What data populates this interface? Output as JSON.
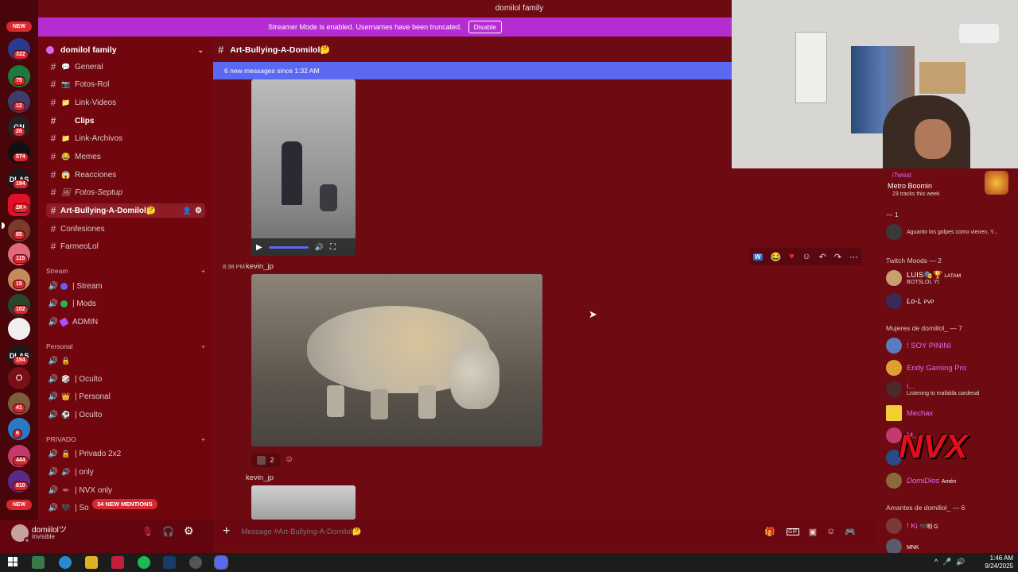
{
  "window": {
    "title": "domilol family"
  },
  "streamer_banner": {
    "message": "Streamer Mode is enabled. Usernames have been truncated.",
    "disable_label": "Disable"
  },
  "servers": {
    "new_top": "NEW",
    "new_bottom": "NEW",
    "badges": [
      "322",
      "75",
      "12",
      "26",
      "574",
      "194",
      "2K+",
      "85",
      "115",
      "15",
      "102",
      "154",
      "41",
      "6",
      "444",
      "810"
    ],
    "letter_o": "O"
  },
  "sidebar": {
    "guild_name": "domilol family",
    "channels": [
      {
        "emoji": "💬",
        "label": "General"
      },
      {
        "emoji": "📷",
        "label": "Fotos-Rol"
      },
      {
        "emoji": "📁",
        "label": "Link-Videos"
      },
      {
        "emoji": "",
        "label": "Clips"
      },
      {
        "emoji": "📁",
        "label": "Link-Archivos"
      },
      {
        "emoji": "😂",
        "label": "Memes"
      },
      {
        "emoji": "😱",
        "label": "Reacciones"
      },
      {
        "emoji": "🖼",
        "label": "Fotos-Septup"
      },
      {
        "emoji": "",
        "label": "Art-Bullying-A-Domilol🤔"
      },
      {
        "emoji": "",
        "label": "Confesiones"
      },
      {
        "emoji": "",
        "label": "FarmeoLol"
      }
    ],
    "cat_stream": "Stream",
    "voice_stream": [
      {
        "label": "| Stream",
        "dot": "#6a5cff"
      },
      {
        "label": "| Mods",
        "dot": "#1db954"
      },
      {
        "label": "ADMIN",
        "dot": "#b04cff"
      }
    ],
    "cat_personal": "Personal",
    "voice_personal": [
      {
        "emoji": "🔒",
        "label": ""
      },
      {
        "emoji": "🎲",
        "label": "| Oculto"
      },
      {
        "emoji": "👑",
        "label": "| Personal"
      },
      {
        "emoji": "⚽",
        "label": "| Oculto"
      }
    ],
    "cat_privado": "PRIVADO",
    "voice_privado": [
      {
        "emoji": "🔒",
        "label": "| Privado 2x2"
      },
      {
        "emoji": "🔊",
        "label": "| only"
      },
      {
        "emoji": "✏",
        "label": "| NVX only"
      },
      {
        "emoji": "🖤",
        "label": "| So"
      }
    ],
    "mentions_pill": "34 NEW MENTIONS"
  },
  "user": {
    "name": "domiilolツ",
    "status": "Invisible"
  },
  "chat": {
    "channel_title": "Art-Bullying-A-Domilol🤔",
    "new_messages": "6 new messages since 1:32 AM",
    "msg_time": "8:38 PM",
    "msg_author": "kevin_jp",
    "reaction_count": "2",
    "msg2_author": "kevin_jp",
    "input_placeholder": "Message #Art-Bullying-A-Domilol🤔"
  },
  "members": {
    "top": {
      "name": "iTwisst",
      "song": "Metro Boomin",
      "sub": "23 tracks this week"
    },
    "group_1": "— 1",
    "g1_member_sub": "Aguanto los golpes como vienen, Y...",
    "group_mods": "Twitch Moods — 2",
    "mods": [
      {
        "name": "LUIS🎭🏆",
        "tag": "LATAM",
        "sub": "BOTSLOL Yt",
        "color": "#fff"
      },
      {
        "name": "Lo·L",
        "tag": "PVP",
        "sub": "",
        "color": "#fff"
      }
    ],
    "group_mujeres": "Mujeres de domillol_ — 7",
    "mujeres": [
      {
        "name": "! SOY PININI",
        "sub": "",
        "color": "#e36cf0"
      },
      {
        "name": "Endy Gaming Pro",
        "sub": "",
        "color": "#e36cf0"
      },
      {
        "name": "i...",
        "sub": "Listening to mafalda cardenal",
        "color": "#e36cf0"
      },
      {
        "name": "Mechax",
        "sub": "",
        "color": "#e36cf0"
      },
      {
        "name": "M...",
        "sub": "",
        "color": "#e36cf0"
      },
      {
        "name": "",
        "sub": "",
        "color": "#e36cf0"
      },
      {
        "name": "DomiDios",
        "sub": "Amén",
        "color": "#e36cf0"
      }
    ],
    "group_amantes": "Amantes de domillol_ — 6",
    "amantes": [
      {
        "name": "! Ki",
        "sub": "🖤明 G",
        "color": "#e36cf0"
      },
      {
        "name": "",
        "sub": "MNK",
        "color": "#e36cf0"
      }
    ]
  },
  "taskbar": {
    "time": "1:46 AM",
    "date": "9/24/2025"
  }
}
